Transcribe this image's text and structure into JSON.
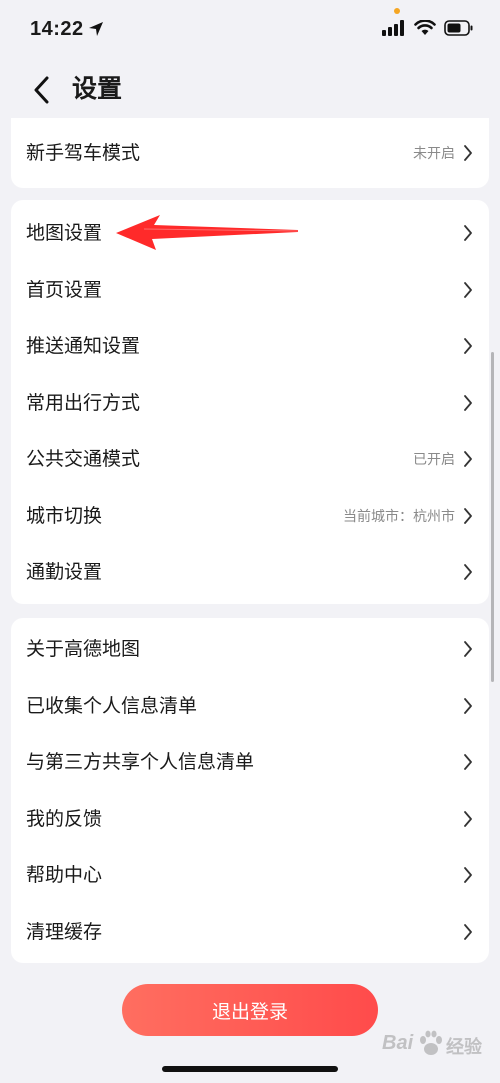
{
  "status_bar": {
    "time": "14:22"
  },
  "header": {
    "title": "设置"
  },
  "sections": [
    {
      "items": [
        {
          "label": "新手驾车模式",
          "value": "未开启"
        }
      ]
    },
    {
      "items": [
        {
          "label": "地图设置",
          "value": ""
        },
        {
          "label": "首页设置",
          "value": ""
        },
        {
          "label": "推送通知设置",
          "value": ""
        },
        {
          "label": "常用出行方式",
          "value": ""
        },
        {
          "label": "公共交通模式",
          "value": "已开启"
        },
        {
          "label": "城市切换",
          "value": "当前城市：杭州市"
        },
        {
          "label": "通勤设置",
          "value": ""
        }
      ]
    },
    {
      "items": [
        {
          "label": "关于高德地图",
          "value": ""
        },
        {
          "label": "已收集个人信息清单",
          "value": ""
        },
        {
          "label": "与第三方共享个人信息清单",
          "value": ""
        },
        {
          "label": "我的反馈",
          "value": ""
        },
        {
          "label": "帮助中心",
          "value": ""
        },
        {
          "label": "清理缓存",
          "value": ""
        }
      ]
    }
  ],
  "logout": {
    "label": "退出登录"
  },
  "watermark": {
    "brand_a": "Bai",
    "brand_b": "经验"
  },
  "colors": {
    "accent": "#ff5a52",
    "annotation_arrow": "#ff2a2a",
    "background": "#f2f2f6"
  }
}
